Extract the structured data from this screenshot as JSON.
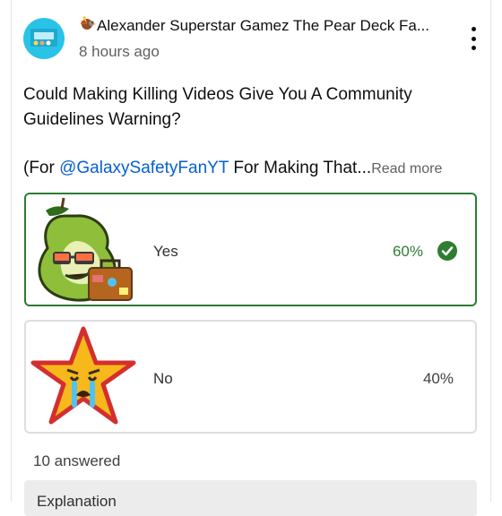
{
  "post": {
    "author": "Alexander Superstar Gamez The Pear Deck Fa...",
    "time": "8 hours ago",
    "question": "Could Making Killing Videos Give You A Community Guidelines Warning?",
    "for_prefix": "(For ",
    "mention": "@GalaxySafetyFanYT",
    "for_suffix": " For Making That...",
    "read_more": "Read more"
  },
  "icons": {
    "author_emoji": "turkey-icon",
    "menu": "more-vert-icon",
    "check": "check-circle-icon"
  },
  "poll": {
    "options": [
      {
        "label": "Yes",
        "percent": "60%",
        "selected": true,
        "image": "pear-with-sunglasses-and-suitcase"
      },
      {
        "label": "No",
        "percent": "40%",
        "selected": false,
        "image": "crying-star"
      }
    ],
    "answered": "10 answered"
  },
  "explanation": {
    "label": "Explanation"
  },
  "colors": {
    "correct": "#2e7d32",
    "mention": "#065fd4",
    "avatar_bg": "#29c3e8"
  }
}
